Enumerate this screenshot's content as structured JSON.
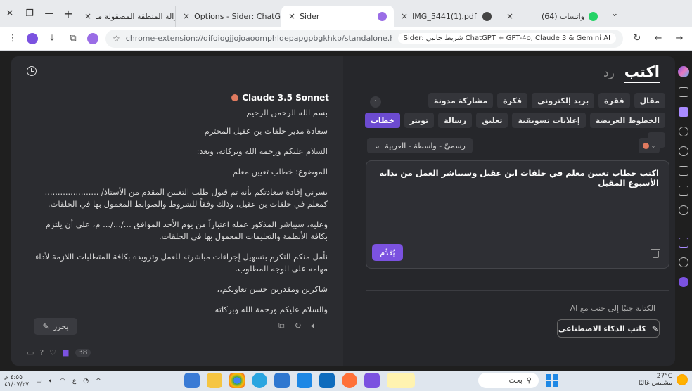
{
  "tabs": [
    {
      "label": "إزالة المنطقة المصقولة مـ",
      "close": "×",
      "color": "#9a6de6"
    },
    {
      "label": "Options - Sider: ChatGPT",
      "close": "×",
      "color": "#9a6de6"
    },
    {
      "label": "Sider",
      "close": "×",
      "color": "#9a6de6",
      "active": true
    },
    {
      "label": "IMG_5441(1).pdf",
      "close": "×",
      "color": "#444444"
    },
    {
      "label": "(64) واتساب",
      "close": "×",
      "color": "#25d366"
    }
  ],
  "address": {
    "url": "chrome-extension://difoiogjjojoaoomphldepapgpbgkhkb/standalone.html?from=sid...",
    "site_chip": "Sider: شريط جانبي ChatGPT + GPT-4o, Claude 3 & Gemini AI"
  },
  "left": {
    "model": "Claude 3.5 Sonnet",
    "letter": [
      "بسم الله الرحمن الرحيم",
      "سعادة مدير حلقات بن عقيل المحترم",
      "السلام عليكم ورحمة الله وبركاته، وبعد:",
      "الموضوع: خطاب تعيين معلم",
      "يسرني إفادة سعادتكم بأنه تم قبول طلب التعيين المقدم من الأستاذ/ ..................... كمعلم في حلقات بن عقيل، وذلك وفقاً للشروط والضوابط المعمول بها في الحلقات.",
      "وعليه، سيباشر المذكور عمله اعتباراً من يوم الأحد الموافق .../.../... م، على أن يلتزم بكافة الأنظمة والتعليمات المعمول بها في الحلقات.",
      "نأمل منكم التكرم بتسهيل إجراءات مباشرته للعمل وتزويده بكافة المتطلبات اللازمة لأداء مهامه على الوجه المطلوب.",
      "شاكرين ومقدرين حسن تعاونكم،،",
      "والسلام عليكم ورحمة الله وبركاته"
    ],
    "edit_label": "يحرر",
    "credits": "38"
  },
  "right": {
    "tab_write": "اكتب",
    "tab_reply": "رد",
    "chips": [
      {
        "label": "مقال"
      },
      {
        "label": "فقرة"
      },
      {
        "label": "بريد إلكتروني"
      },
      {
        "label": "فكرة"
      },
      {
        "label": "مشاركة مدونة"
      },
      {
        "label": "الخطوط العريضة"
      },
      {
        "label": "إعلانات تسويقية"
      },
      {
        "label": "تعليق"
      },
      {
        "label": "رسالة"
      },
      {
        "label": "تويتر"
      },
      {
        "label": "خطاب",
        "selected": true
      },
      {
        "label": "+"
      }
    ],
    "tone": "رسميّ - واسطة - العربية",
    "prompt": "اكتب خطاب تعيين معلم في حلقات ابن عقيل وسيباشر العمل من بداية الأسبوع المقبل",
    "submit": "يُقدِّم",
    "ai_label": "الكتابة جنبًا إلى جنب مع AI",
    "ai_button": "كاتب الذكاء الاصطناعي"
  },
  "taskbar": {
    "search": "بحث",
    "weather_temp": "27°C",
    "weather_desc": "مشمس غالبًا",
    "time": "٤:٥٥ م",
    "date": "٤١/٠٧/٢٧"
  },
  "colors": {
    "accent": "#7b52e0",
    "selected_chip": "#6c4bd0"
  }
}
